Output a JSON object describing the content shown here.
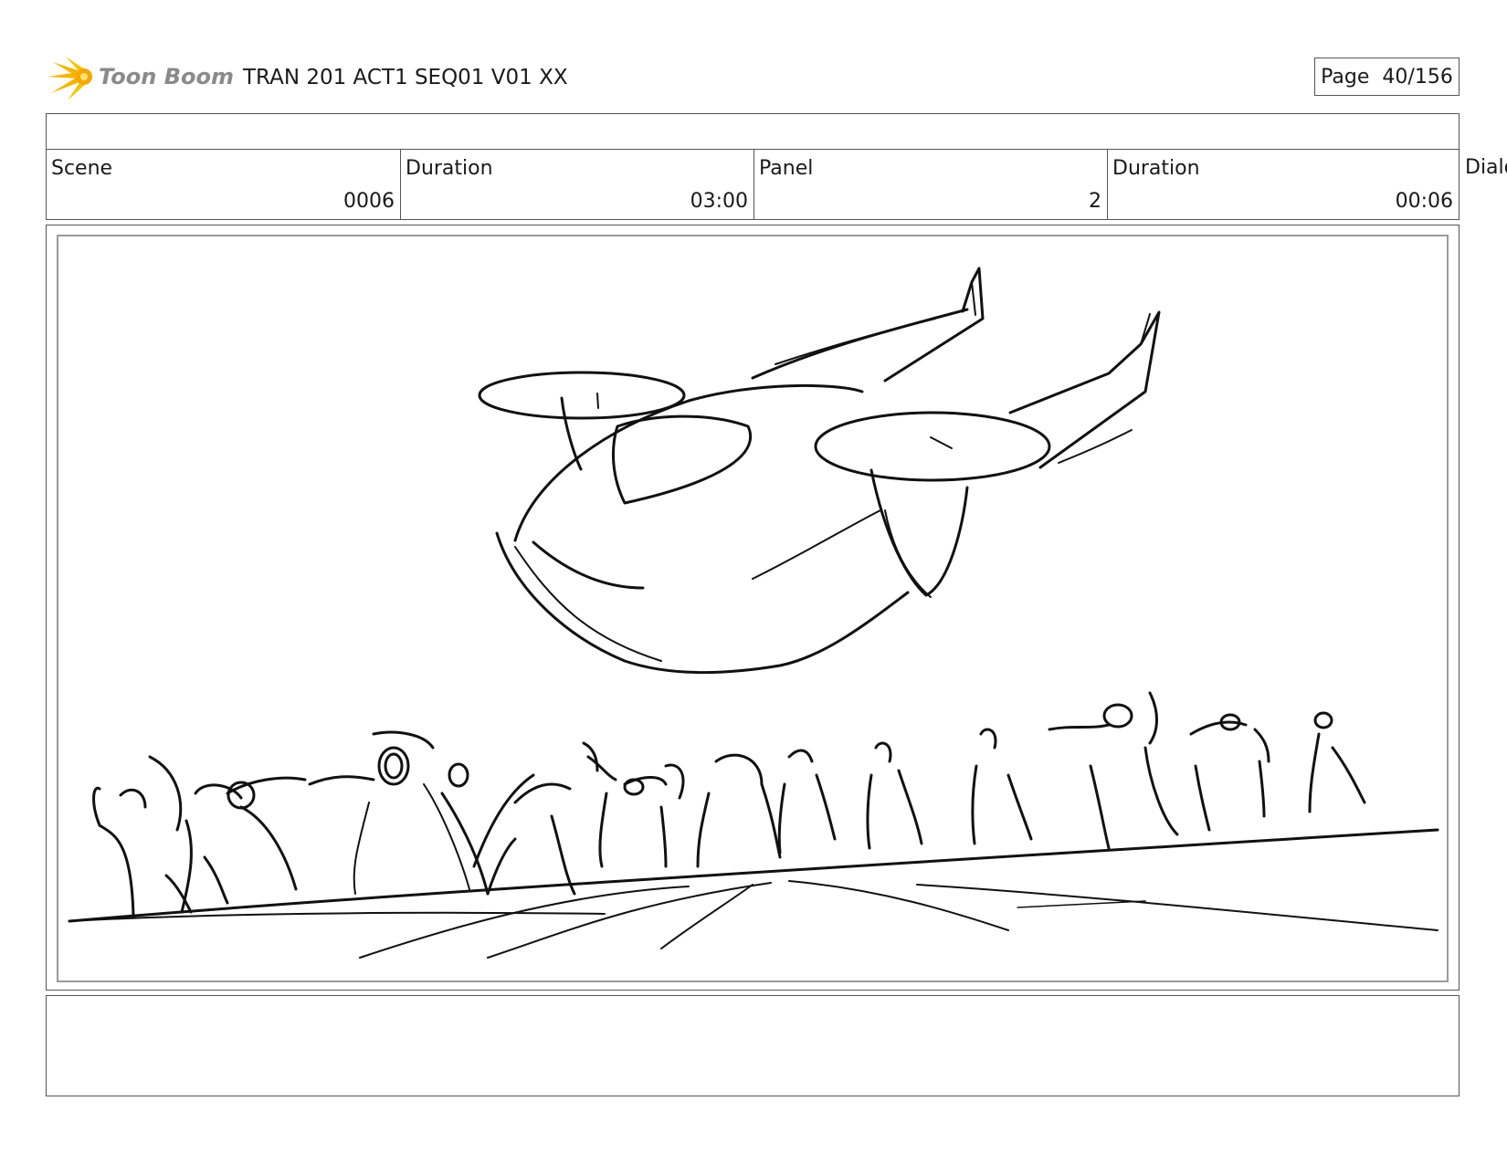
{
  "header": {
    "logo_text": "Toon Boom",
    "doc_title": "TRAN 201 ACT1 SEQ01 V01 XX",
    "page_label": "Page",
    "page_value": "40/156"
  },
  "info": {
    "scene_label": "Scene",
    "scene_value": "0006",
    "scene_duration_label": "Duration",
    "scene_duration_value": "03:00",
    "panel_label": "Panel",
    "panel_value": "2",
    "panel_duration_label": "Duration",
    "panel_duration_value": "00:06",
    "dialog_label_partial": "Dialo"
  },
  "colors": {
    "logo_accent": "#f5b400",
    "ink": "#111111"
  },
  "icons": [
    "toon-boom-logo-icon"
  ]
}
